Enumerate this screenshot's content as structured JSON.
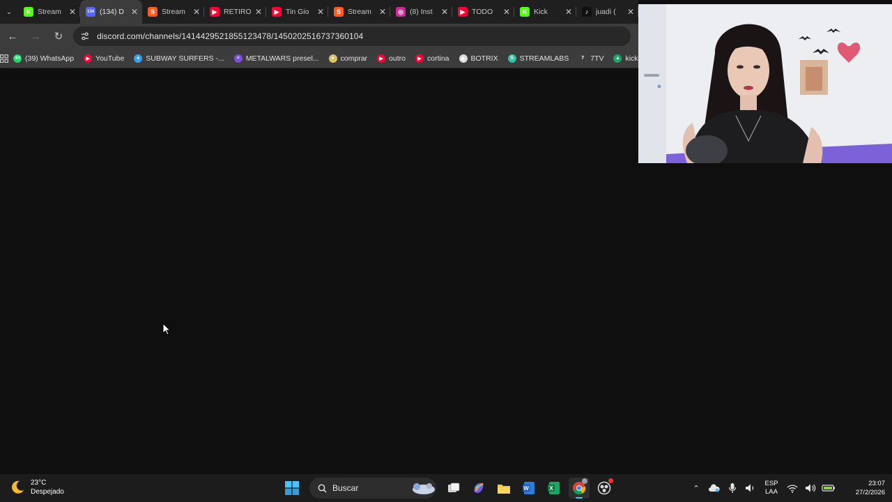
{
  "browser": {
    "tabs": [
      {
        "title": "Stream",
        "favicon": "kick-icon",
        "color": "#53fc18",
        "glyph": "K",
        "active": false
      },
      {
        "title": "(134) D",
        "favicon": "discord-icon",
        "color": "#5865f2",
        "glyph": "134",
        "active": true
      },
      {
        "title": "Stream",
        "favicon": "streamlabs-icon",
        "color": "#ff5a1f",
        "glyph": "S",
        "active": false
      },
      {
        "title": "RETIRO",
        "favicon": "youtube-icon",
        "color": "#ff0033",
        "glyph": "▶",
        "active": false
      },
      {
        "title": "Tin Gio",
        "favicon": "youtube-icon",
        "color": "#ff0033",
        "glyph": "▶",
        "active": false
      },
      {
        "title": "Stream",
        "favicon": "streamlabs-icon",
        "color": "#ff5a1f",
        "glyph": "S",
        "active": false
      },
      {
        "title": "(8) Inst",
        "favicon": "instagram-icon",
        "color": "#d6249f",
        "glyph": "◎",
        "active": false
      },
      {
        "title": "TODO",
        "favicon": "youtube-icon",
        "color": "#ff0033",
        "glyph": "▶",
        "active": false
      },
      {
        "title": "Kick",
        "favicon": "kick-icon",
        "color": "#53fc18",
        "glyph": "K",
        "active": false
      },
      {
        "title": "juadi (",
        "favicon": "tiktok-icon",
        "color": "#111111",
        "glyph": "♪",
        "active": false
      }
    ],
    "url": "discord.com/channels/1414429521855123478/1450202516737360104",
    "bookmarks": [
      {
        "label": "(39) WhatsApp",
        "icon": "whatsapp-icon",
        "color": "#25d366",
        "glyph": "44"
      },
      {
        "label": "YouTube",
        "icon": "youtube-icon",
        "color": "#ff0033",
        "glyph": "▶"
      },
      {
        "label": "SUBWAY SURFERS -...",
        "icon": "subway-icon",
        "color": "#3aa0e8",
        "glyph": "●"
      },
      {
        "label": "METALWARS presel...",
        "icon": "list-icon",
        "color": "#7b4fd6",
        "glyph": "≡"
      },
      {
        "label": "comprar",
        "icon": "shop-icon",
        "color": "#d9c26a",
        "glyph": "●"
      },
      {
        "label": "outro",
        "icon": "youtube-icon",
        "color": "#ff0033",
        "glyph": "▶"
      },
      {
        "label": "cortina",
        "icon": "youtube-icon",
        "color": "#ff0033",
        "glyph": "▶"
      },
      {
        "label": "BOTRIX",
        "icon": "botrix-icon",
        "color": "#dddddd",
        "glyph": "◆"
      },
      {
        "label": "STREAMLABS",
        "icon": "streamlabs-icon",
        "color": "#31c3a2",
        "glyph": "S"
      },
      {
        "label": "7TV",
        "icon": "7tv-icon",
        "color": "#3c3c3c",
        "glyph": "7"
      },
      {
        "label": "kick - G",
        "icon": "drive-icon",
        "color": "#1fa463",
        "glyph": "▲"
      }
    ]
  },
  "taskbar": {
    "weather": {
      "temp": "23°C",
      "condition": "Despejado"
    },
    "search_placeholder": "Buscar",
    "lang_top": "ESP",
    "lang_bottom": "LAA",
    "time": "23:07",
    "date": "27/2/2026"
  }
}
